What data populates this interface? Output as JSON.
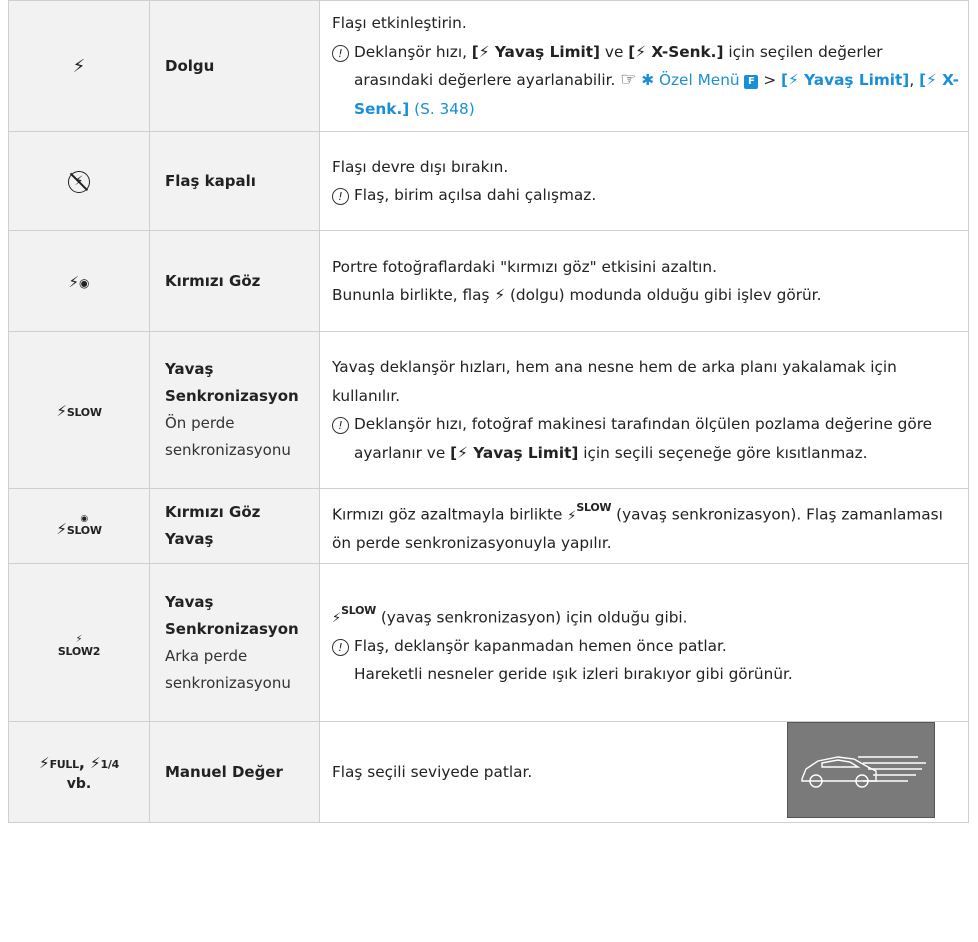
{
  "rows": [
    {
      "icon": "⚡",
      "name": "Dolgu",
      "desc1": "Flaşı etkinleştirin.",
      "note_a": "Deklanşör hızı, ",
      "note_b": "[⚡ Yavaş Limit]",
      "note_c": " ve ",
      "note_d": "[⚡ X-Senk.]",
      "note_e": " için seçilen değerler arasındaki değerlere ayarlanabilir.",
      "ref_arrow": "☞",
      "ref_menu": "✱ Özel Menü",
      "ref_badge": "F",
      "ref_sep": ">",
      "ref_item1": "[⚡ Yavaş Limit]",
      "ref_comma": ",",
      "ref_item2": "[⚡ X-Senk.]",
      "ref_page": "(S. 348)"
    },
    {
      "icon": "⚡",
      "name": "Flaş kapalı",
      "desc1": "Flaşı devre dışı bırakın.",
      "note": "Flaş, birim açılsa dahi çalışmaz."
    },
    {
      "icon_main": "⚡",
      "icon_sub": "◉",
      "name": "Kırmızı Göz",
      "desc1": "Portre fotoğraflardaki \"kırmızı göz\" etkisini azaltın.",
      "desc2": "Bununla birlikte, flaş ⚡ (dolgu) modunda olduğu gibi işlev görür."
    },
    {
      "icon_text": "SLOW",
      "name1": "Yavaş",
      "name2": "Senkronizasyon",
      "sub1": "Ön perde",
      "sub2": "senkronizasyonu",
      "desc1": "Yavaş deklanşör hızları, hem ana nesne hem de arka planı yakalamak için kullanılır.",
      "note_a": "Deklanşör hızı, fotoğraf makinesi tarafından ölçülen pozlama değerine göre ayarlanır ve ",
      "note_b": "[⚡ Yavaş Limit]",
      "note_c": " için seçili seçeneğe göre kısıtlanmaz."
    },
    {
      "icon_text": "SLOW",
      "name1": "Kırmızı Göz",
      "name2": "Yavaş",
      "desc_a": "Kırmızı göz azaltmayla birlikte ",
      "desc_icon": "SLOW",
      "desc_b": " (yavaş senkronizasyon). Flaş zamanlaması ön perde senkronizasyonuyla yapılır."
    },
    {
      "icon_text": "SLOW2",
      "name1": "Yavaş",
      "name2": "Senkronizasyon",
      "sub1": "Arka perde",
      "sub2": "senkronizasyonu",
      "desc_icon": "SLOW",
      "desc_b": " (yavaş senkronizasyon) için olduğu gibi.",
      "note": "Flaş, deklanşör kapanmadan hemen önce patlar. Hareketli nesneler geride ışık izleri bırakıyor gibi görünür."
    },
    {
      "icon_t1": "FULL",
      "icon_sep": ",",
      "icon_t2": "1/4",
      "icon_vb": "vb.",
      "name": "Manuel Değer",
      "desc1": "Flaş seçili seviyede patlar."
    }
  ]
}
